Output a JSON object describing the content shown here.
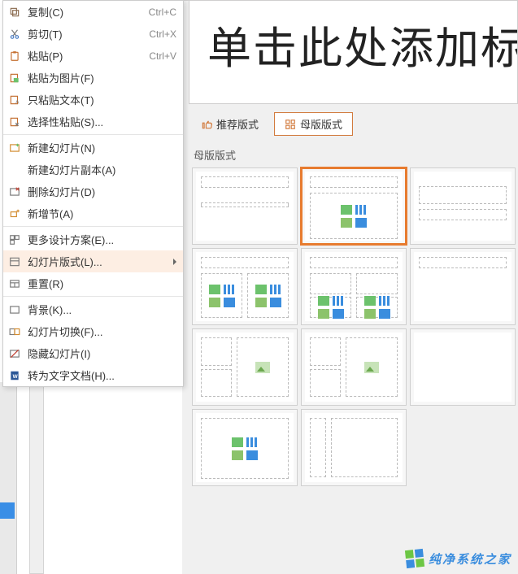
{
  "title_placeholder": "单击此处添加标",
  "tabs": {
    "recommended": "推荐版式",
    "master": "母版版式"
  },
  "section_label": "母版版式",
  "watermark": "纯净系统之家",
  "selected_layout_index": 1,
  "context_menu": [
    {
      "icon": "copy-icon",
      "label": "复制(C)",
      "shortcut": "Ctrl+C"
    },
    {
      "icon": "cut-icon",
      "label": "剪切(T)",
      "shortcut": "Ctrl+X"
    },
    {
      "icon": "paste-icon",
      "label": "粘贴(P)",
      "shortcut": "Ctrl+V"
    },
    {
      "icon": "paste-image-icon",
      "label": "粘贴为图片(F)",
      "shortcut": ""
    },
    {
      "icon": "paste-text-icon",
      "label": "只粘贴文本(T)",
      "shortcut": ""
    },
    {
      "icon": "paste-special-icon",
      "label": "选择性粘贴(S)...",
      "shortcut": ""
    },
    {
      "sep": true
    },
    {
      "icon": "new-slide-icon",
      "label": "新建幻灯片(N)",
      "shortcut": ""
    },
    {
      "icon": "",
      "label": "新建幻灯片副本(A)",
      "shortcut": ""
    },
    {
      "icon": "delete-slide-icon",
      "label": "删除幻灯片(D)",
      "shortcut": ""
    },
    {
      "icon": "new-section-icon",
      "label": "新增节(A)",
      "shortcut": ""
    },
    {
      "sep": true
    },
    {
      "icon": "design-icon",
      "label": "更多设计方案(E)...",
      "shortcut": ""
    },
    {
      "icon": "layout-icon",
      "label": "幻灯片版式(L)...",
      "shortcut": "",
      "highlight": true,
      "submenu": true
    },
    {
      "icon": "reset-icon",
      "label": "重置(R)",
      "shortcut": ""
    },
    {
      "sep": true
    },
    {
      "icon": "background-icon",
      "label": "背景(K)...",
      "shortcut": ""
    },
    {
      "icon": "transition-icon",
      "label": "幻灯片切换(F)...",
      "shortcut": ""
    },
    {
      "icon": "hide-slide-icon",
      "label": "隐藏幻灯片(I)",
      "shortcut": ""
    },
    {
      "icon": "to-word-icon",
      "label": "转为文字文档(H)...",
      "shortcut": ""
    }
  ],
  "icon_colors": {
    "copy": "#8a6b4f",
    "cut": "#4a7dc4",
    "paste": "#c46e2f",
    "delete": "#c0392b",
    "new": "#d28b2e",
    "misc": "#7a7a7a",
    "word": "#2b5797"
  }
}
